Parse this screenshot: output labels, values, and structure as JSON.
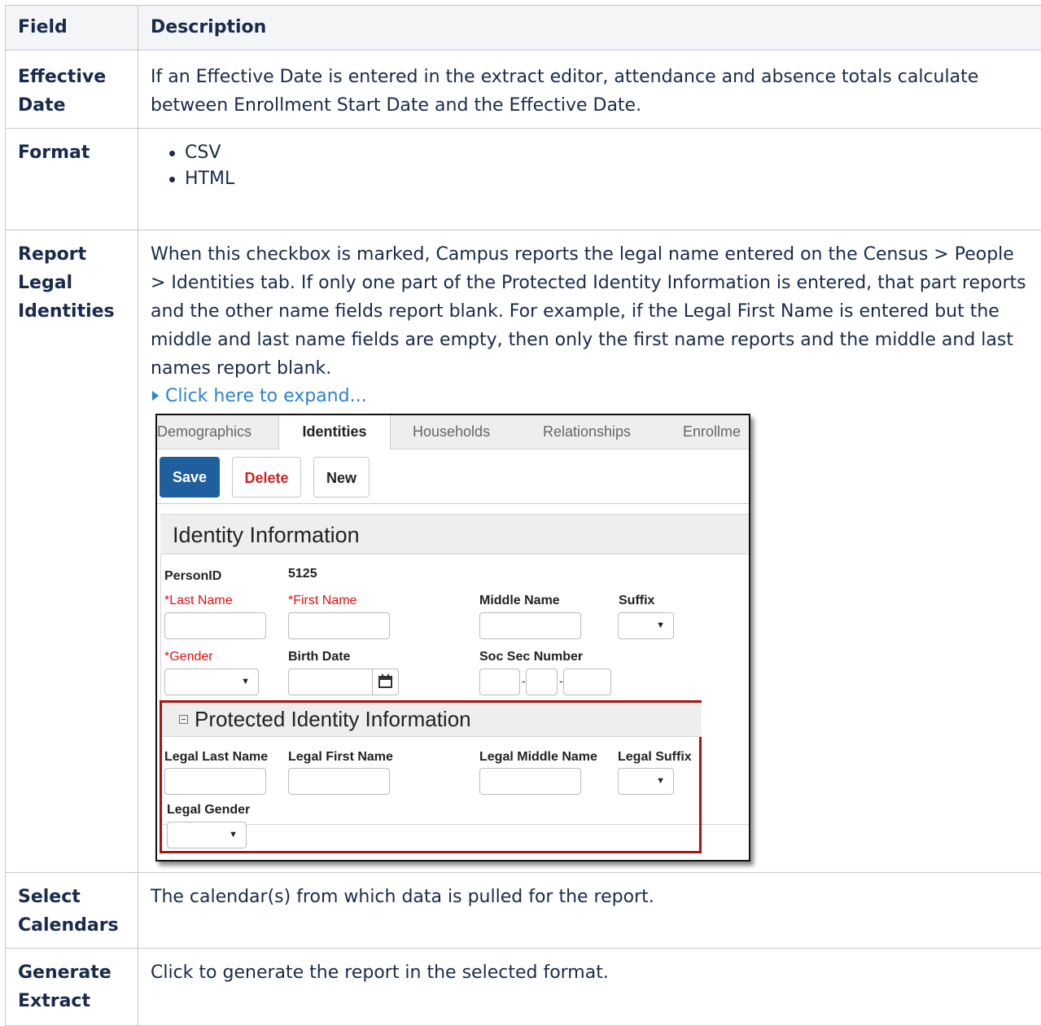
{
  "table": {
    "headers": {
      "field": "Field",
      "description": "Description"
    },
    "rows": {
      "effective_date": {
        "field": "Effective Date",
        "description": "If an Effective Date is entered in the extract editor, attendance and absence totals calculate between Enrollment Start Date and the Effective Date."
      },
      "format": {
        "field": "Format",
        "options": [
          "CSV",
          "HTML"
        ]
      },
      "report_legal_identities": {
        "field": "Report Legal Identities",
        "description": "When this checkbox is marked, Campus reports the legal name entered on the Census > People > Identities tab. If only one part of the Protected Identity Information is entered, that part reports and the other name fields report blank. For example, if the Legal First Name is entered but the middle and last name fields are empty, then only the first name reports and the middle and last names report blank.",
        "expand_link": "Click here to expand..."
      },
      "select_calendars": {
        "field": "Select Calendars",
        "description": "The calendar(s) from which data is pulled for the report."
      },
      "generate_extract": {
        "field": "Generate Extract",
        "description": "Click to generate the report in the selected format."
      }
    }
  },
  "screenshot": {
    "tabs": [
      "Demographics",
      "Identities",
      "Households",
      "Relationships",
      "Enrollme"
    ],
    "active_tab": "Identities",
    "buttons": {
      "save": "Save",
      "delete": "Delete",
      "new": "New"
    },
    "identity_section": {
      "title": "Identity Information",
      "person_id_label": "PersonID",
      "person_id_value": "5125",
      "last_name": "*Last Name",
      "first_name": "*First Name",
      "middle_name": "Middle Name",
      "suffix": "Suffix",
      "gender": "*Gender",
      "birth_date": "Birth Date",
      "ssn": "Soc Sec Number",
      "ssn_sep": "-"
    },
    "protected_section": {
      "title": "Protected Identity Information",
      "legal_last_name": "Legal Last Name",
      "legal_first_name": "Legal First Name",
      "legal_middle_name": "Legal Middle Name",
      "legal_suffix": "Legal Suffix",
      "legal_gender": "Legal Gender"
    },
    "highlight_color": "#aa1111",
    "primary_button_color": "#1f5f9e"
  },
  "colors": {
    "text": "#172b4d",
    "link": "#2e82d1",
    "header_bg": "#f4f5f7",
    "border": "#c1c7d0"
  }
}
